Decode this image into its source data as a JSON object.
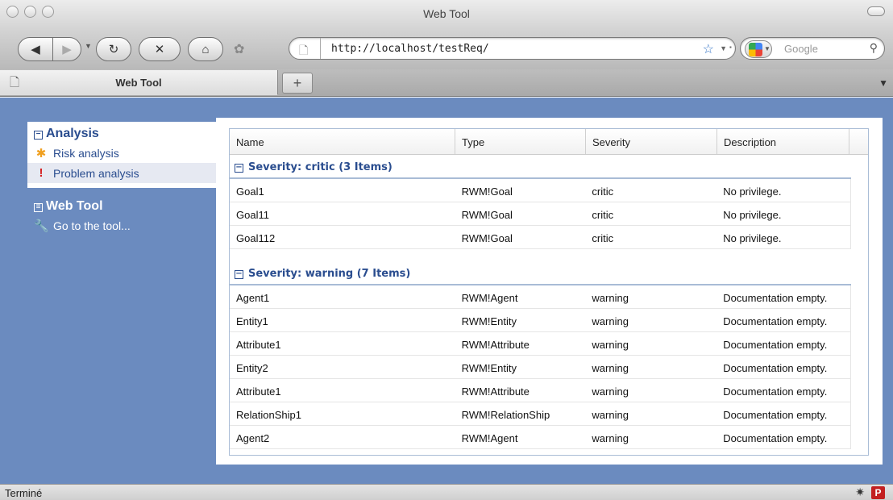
{
  "window": {
    "title": "Web Tool"
  },
  "nav": {
    "url": "http://localhost/testReq/",
    "search_placeholder": "Google"
  },
  "tabs": [
    {
      "label": "Web Tool"
    }
  ],
  "new_tab_label": "+",
  "sidebar": {
    "analysis": {
      "title": "Analysis",
      "items": [
        {
          "label": "Risk analysis",
          "icon": "asterisk-icon"
        },
        {
          "label": "Problem analysis",
          "icon": "exclamation-icon",
          "selected": true
        }
      ]
    },
    "webtool": {
      "title": "Web Tool",
      "items": [
        {
          "label": "Go to the tool...",
          "icon": "wrench-icon"
        }
      ]
    }
  },
  "grid": {
    "columns": [
      "Name",
      "Type",
      "Severity",
      "Description"
    ],
    "groups": [
      {
        "label": "Severity: critic (3 Items)",
        "rows": [
          [
            "Goal1",
            "RWM!Goal",
            "critic",
            "No privilege."
          ],
          [
            "Goal11",
            "RWM!Goal",
            "critic",
            "No privilege."
          ],
          [
            "Goal112",
            "RWM!Goal",
            "critic",
            "No privilege."
          ]
        ]
      },
      {
        "label": "Severity: warning (7 Items)",
        "rows": [
          [
            "Agent1",
            "RWM!Agent",
            "warning",
            "Documentation empty."
          ],
          [
            "Entity1",
            "RWM!Entity",
            "warning",
            "Documentation empty."
          ],
          [
            "Attribute1",
            "RWM!Attribute",
            "warning",
            "Documentation empty."
          ],
          [
            "Entity2",
            "RWM!Entity",
            "warning",
            "Documentation empty."
          ],
          [
            "Attribute1",
            "RWM!Attribute",
            "warning",
            "Documentation empty."
          ],
          [
            "RelationShip1",
            "RWM!RelationShip",
            "warning",
            "Documentation empty."
          ],
          [
            "Agent2",
            "RWM!Agent",
            "warning",
            "Documentation empty."
          ]
        ]
      }
    ]
  },
  "status": {
    "text": "Terminé",
    "badge": "P"
  },
  "colors": {
    "content_bg": "#6b8bbf",
    "accent": "#2a4d8f",
    "badge": "#c32020"
  }
}
